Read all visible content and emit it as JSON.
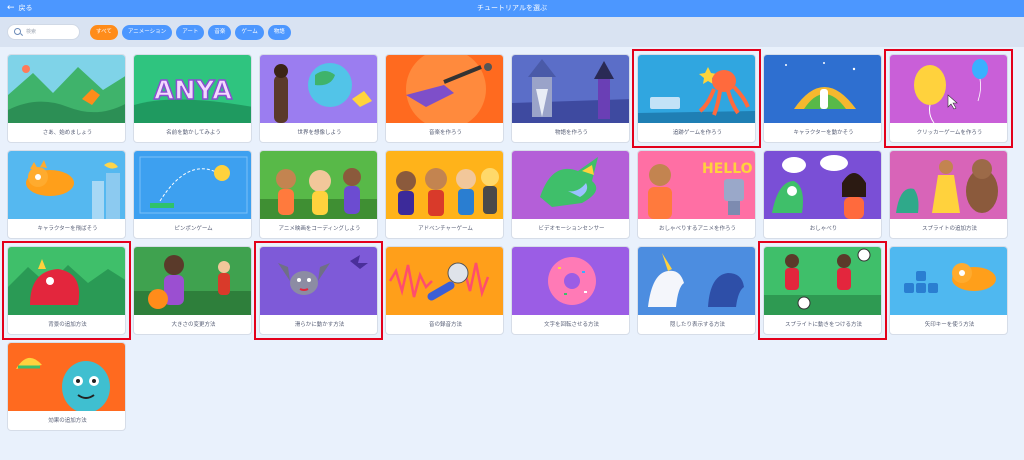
{
  "header": {
    "back_label": "戻る",
    "title": "チュートリアルを選ぶ",
    "back_icon": "arrow-left-icon"
  },
  "search": {
    "placeholder": "検索",
    "icon": "search-icon"
  },
  "tags": [
    "すべて",
    "アニメーション",
    "アート",
    "音楽",
    "ゲーム",
    "物語"
  ],
  "active_tag": "すべて",
  "colors": {
    "header": "#4c97ff",
    "active_tag": "#ff8c1a",
    "highlight": "#e3001b"
  },
  "tutorials": [
    {
      "label": "さあ、始めましょう",
      "highlighted": false
    },
    {
      "label": "名前を動かしてみよう",
      "highlighted": false,
      "art_text": "ANYA"
    },
    {
      "label": "世界を想像しよう",
      "highlighted": false
    },
    {
      "label": "音楽を作ろう",
      "highlighted": false
    },
    {
      "label": "物語を作ろう",
      "highlighted": false
    },
    {
      "label": "追跡ゲームを作ろう",
      "highlighted": true
    },
    {
      "label": "キャラクターを動かそう",
      "highlighted": false
    },
    {
      "label": "クリッカーゲームを作ろう",
      "highlighted": true
    },
    {
      "label": "キャラクターを飛ばそう",
      "highlighted": false
    },
    {
      "label": "ピンポンゲーム",
      "highlighted": false
    },
    {
      "label": "アニメ映画をコーディングしよう",
      "highlighted": false
    },
    {
      "label": "アドベンチャーゲーム",
      "highlighted": false
    },
    {
      "label": "ビデオモーションセンサー",
      "highlighted": false
    },
    {
      "label": "おしゃべりするアニメを作ろう",
      "highlighted": false,
      "art_text": "HELLO"
    },
    {
      "label": "おしゃべり",
      "highlighted": false
    },
    {
      "label": "スプライトの追加方法",
      "highlighted": false
    },
    {
      "label": "背景の追加方法",
      "highlighted": true
    },
    {
      "label": "大きさの変更方法",
      "highlighted": false
    },
    {
      "label": "滑らかに動かす方法",
      "highlighted": true
    },
    {
      "label": "音の録音方法",
      "highlighted": false
    },
    {
      "label": "文字を回転させる方法",
      "highlighted": false
    },
    {
      "label": "隠したり表示する方法",
      "highlighted": false
    },
    {
      "label": "スプライトに動きをつける方法",
      "highlighted": true
    },
    {
      "label": "矢印キーを使う方法",
      "highlighted": false
    },
    {
      "label": "効果の追加方法",
      "highlighted": false
    }
  ]
}
